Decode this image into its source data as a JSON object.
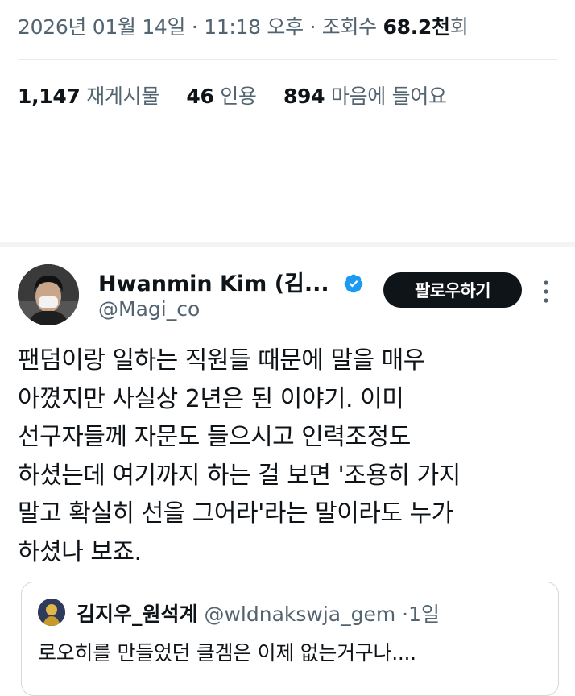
{
  "meta": {
    "date": "2026년 01월 14일",
    "separator": "·",
    "time": "11:18 오후",
    "views_label": "조회수",
    "views_value": "68.2천",
    "views_suffix": "회"
  },
  "stats": {
    "reposts_count": "1,147",
    "reposts_label": "재게시물",
    "quotes_count": "46",
    "quotes_label": "인용",
    "likes_count": "894",
    "likes_label": "마음에 들어요"
  },
  "tweet": {
    "author_name": "Hwanmin Kim (김...",
    "author_handle": "@Magi_co",
    "follow_label": "팔로우하기",
    "verified_color": "#1d9bf0",
    "lines": [
      "팬덤이랑 일하는 직원들 때문에 말을 매우",
      "아꼈지만 사실상 2년은 된 이야기. 이미",
      "선구자들께 자문도 들으시고 인력조정도",
      "하셨는데 여기까지 하는 걸 보면 '조용히 가지",
      "말고 확실히 선을 그어라'라는 말이라도 누가",
      "하셨나 보죠."
    ]
  },
  "quote": {
    "name": "김지우_원석계",
    "handle": "@wldnakswja_gem",
    "separator": "·",
    "time": "1일",
    "text": "로오히를 만들었던 클겜은 이제 없는거구나...."
  },
  "colors": {
    "text_primary": "#0f1419",
    "text_secondary": "#536471",
    "border": "#cfd9de"
  }
}
